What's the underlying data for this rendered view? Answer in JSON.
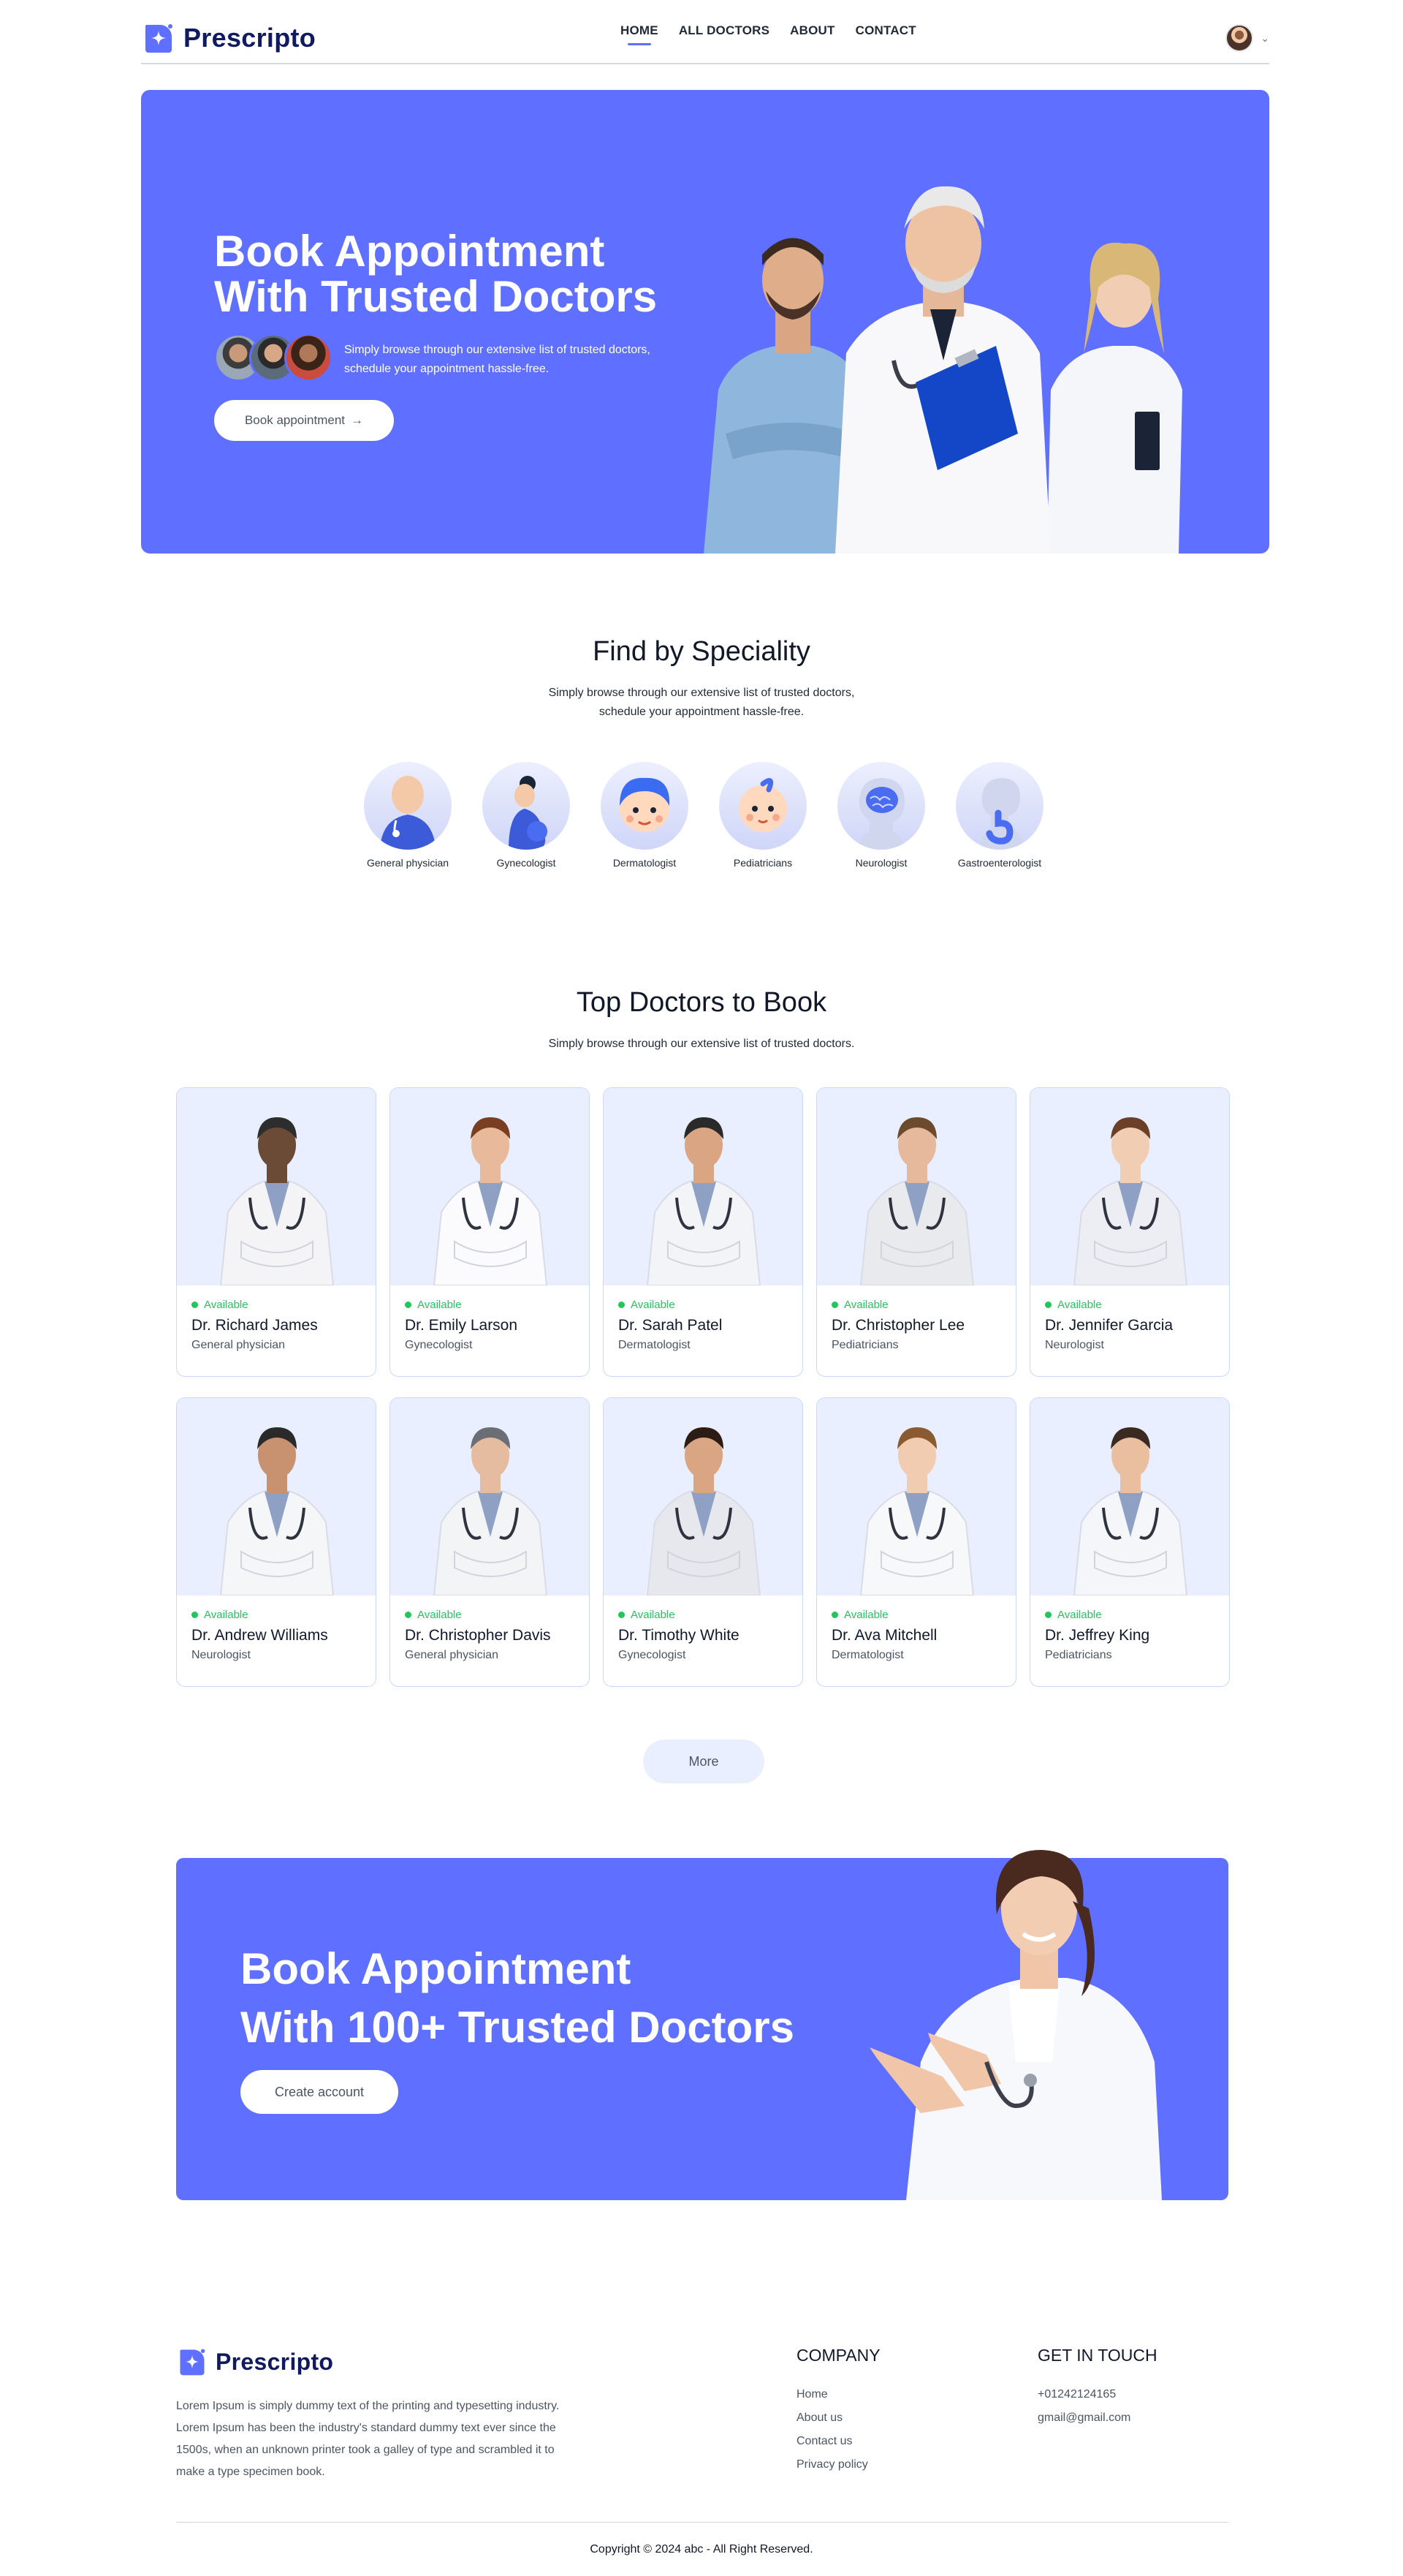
{
  "brand": {
    "name": "Prescripto",
    "color": "#5f6fff",
    "dark": "#111a5e"
  },
  "nav": {
    "links": [
      "HOME",
      "ALL DOCTORS",
      "ABOUT",
      "CONTACT"
    ],
    "active": "HOME"
  },
  "hero": {
    "title_line1": "Book Appointment",
    "title_line2": "With Trusted Doctors",
    "subtitle_line1": "Simply browse through our extensive list of trusted doctors,",
    "subtitle_line2": "schedule your appointment hassle-free.",
    "button": "Book appointment",
    "button_arrow": "→"
  },
  "speciality": {
    "title": "Find by Speciality",
    "subtitle_line1": "Simply browse through our extensive list of trusted doctors,",
    "subtitle_line2": "schedule your appointment hassle-free.",
    "items": [
      {
        "label": "General physician",
        "icon": "general-physician-icon"
      },
      {
        "label": "Gynecologist",
        "icon": "gynecologist-icon"
      },
      {
        "label": "Dermatologist",
        "icon": "dermatologist-icon"
      },
      {
        "label": "Pediatricians",
        "icon": "pediatricians-icon"
      },
      {
        "label": "Neurologist",
        "icon": "neurologist-icon"
      },
      {
        "label": "Gastroenterologist",
        "icon": "gastroenterologist-icon"
      }
    ]
  },
  "top_doctors": {
    "title": "Top Doctors to Book",
    "subtitle": "Simply browse through our extensive list of trusted doctors.",
    "status_label": "Available",
    "doctors": [
      {
        "name": "Dr. Richard James",
        "speciality": "General physician"
      },
      {
        "name": "Dr. Emily Larson",
        "speciality": "Gynecologist"
      },
      {
        "name": "Dr. Sarah Patel",
        "speciality": "Dermatologist"
      },
      {
        "name": "Dr. Christopher Lee",
        "speciality": "Pediatricians"
      },
      {
        "name": "Dr. Jennifer Garcia",
        "speciality": "Neurologist"
      },
      {
        "name": "Dr. Andrew Williams",
        "speciality": "Neurologist"
      },
      {
        "name": "Dr. Christopher Davis",
        "speciality": "General physician"
      },
      {
        "name": "Dr. Timothy White",
        "speciality": "Gynecologist"
      },
      {
        "name": "Dr. Ava Mitchell",
        "speciality": "Dermatologist"
      },
      {
        "name": "Dr. Jeffrey King",
        "speciality": "Pediatricians"
      }
    ],
    "more_button": "More"
  },
  "banner": {
    "title_line1": "Book Appointment",
    "title_line2": "With 100+ Trusted Doctors",
    "button": "Create account"
  },
  "footer": {
    "description": "Lorem Ipsum is simply dummy text of the printing and typesetting industry. Lorem Ipsum has been the industry's standard dummy text ever since the 1500s, when an unknown printer took a galley of type and scrambled it to make a type specimen book.",
    "company_heading": "COMPANY",
    "company_links": [
      "Home",
      "About us",
      "Contact us",
      "Privacy policy"
    ],
    "contact_heading": "GET IN TOUCH",
    "phone": "+01242124165",
    "email": "gmail@gmail.com",
    "copyright": "Copyright © 2024 abc - All Right Reserved."
  }
}
